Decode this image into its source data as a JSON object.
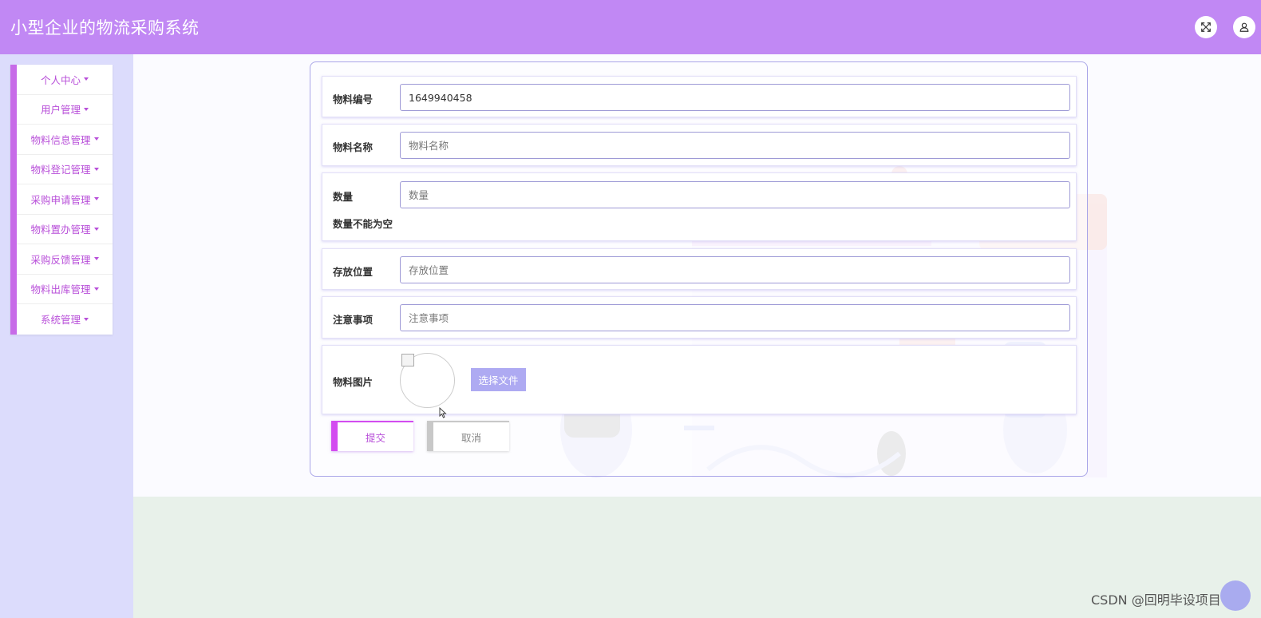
{
  "app": {
    "title": "小型企业的物流采购系统"
  },
  "header": {
    "icons": [
      "fullscreen-icon",
      "user-icon"
    ]
  },
  "sidebar": {
    "items": [
      {
        "label": "个人中心"
      },
      {
        "label": "用户管理"
      },
      {
        "label": "物料信息管理"
      },
      {
        "label": "物料登记管理"
      },
      {
        "label": "采购申请管理"
      },
      {
        "label": "物料置办管理"
      },
      {
        "label": "采购反馈管理"
      },
      {
        "label": "物料出库管理"
      },
      {
        "label": "系统管理"
      }
    ]
  },
  "form": {
    "code": {
      "label": "物料编号",
      "value": "1649940458"
    },
    "name": {
      "label": "物料名称",
      "placeholder": "物料名称"
    },
    "quantity": {
      "label": "数量",
      "placeholder": "数量",
      "error": "数量不能为空"
    },
    "location": {
      "label": "存放位置",
      "placeholder": "存放位置"
    },
    "notes": {
      "label": "注意事项",
      "placeholder": "注意事项"
    },
    "image": {
      "label": "物料图片",
      "choose_label": "选择文件"
    },
    "submit_label": "提交",
    "cancel_label": "取消"
  },
  "watermark": "CSDN @回明毕设项目",
  "colors": {
    "header": "#c188f4",
    "accent": "#c76be8",
    "sidebar_bg": "#dcdcfc",
    "choose_button": "#aeaaf2"
  }
}
